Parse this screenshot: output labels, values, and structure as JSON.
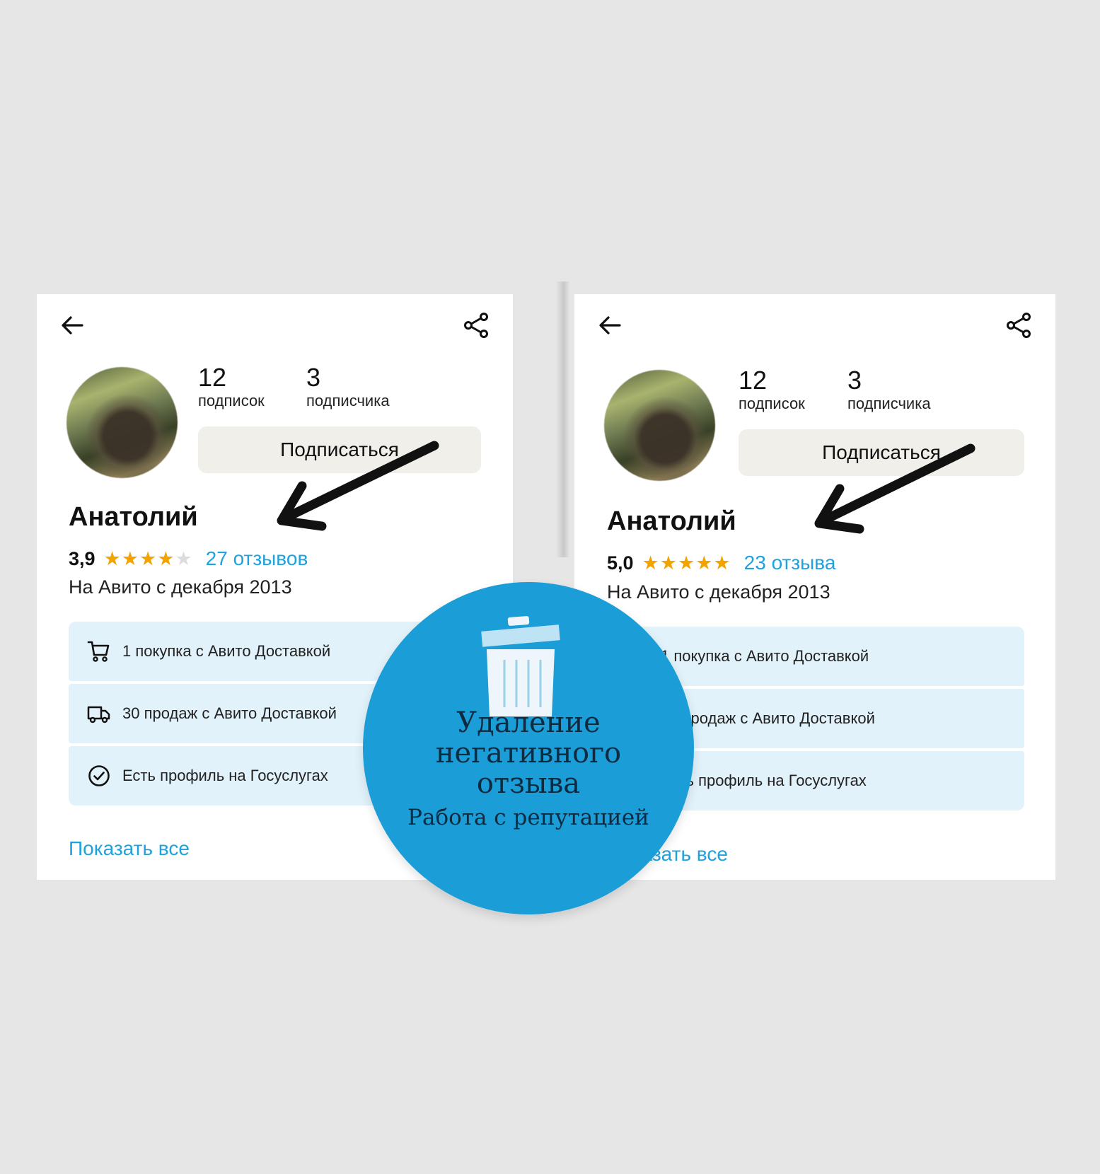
{
  "cards": [
    {
      "followings_count": "12",
      "followings_label": "подписок",
      "followers_count": "3",
      "followers_label": "подписчика",
      "subscribe_label": "Подписаться",
      "name": "Анатолий",
      "rating": "3,9",
      "stars_filled": 4,
      "reviews_link": "27 отзывов",
      "since": "На Авито с декабря 2013",
      "items": [
        {
          "icon": "cart-icon",
          "text": "1 покупка с Авито Доставкой"
        },
        {
          "icon": "truck-icon",
          "text": "30 продаж с Авито Доставкой"
        },
        {
          "icon": "check-circle-icon",
          "text": "Есть профиль на Госуслугах"
        }
      ],
      "show_all": "Показать все"
    },
    {
      "followings_count": "12",
      "followings_label": "подписок",
      "followers_count": "3",
      "followers_label": "подписчика",
      "subscribe_label": "Подписаться",
      "name": "Анатолий",
      "rating": "5,0",
      "stars_filled": 5,
      "reviews_link": "23 отзыва",
      "since": "На Авито с декабря 2013",
      "items": [
        {
          "icon": "cart-icon",
          "text": "1 покупка с Авито Доставкой"
        },
        {
          "icon": "truck-icon",
          "text": "30 продаж с Авито Доставкой"
        },
        {
          "icon": "check-circle-icon",
          "text": "Есть профиль на Госуслугах"
        }
      ],
      "show_all": "Показать все"
    }
  ],
  "badge": {
    "title_line1": "Удаление",
    "title_line2": "негативного",
    "title_line3": "отзыва",
    "subtitle": "Работа с репутацией"
  },
  "colors": {
    "page_bg": "#e6e6e6",
    "link": "#1fa2dd",
    "star": "#f2a300",
    "info_bg": "#e2f2fb",
    "badge_bg": "#1b9dd8"
  }
}
